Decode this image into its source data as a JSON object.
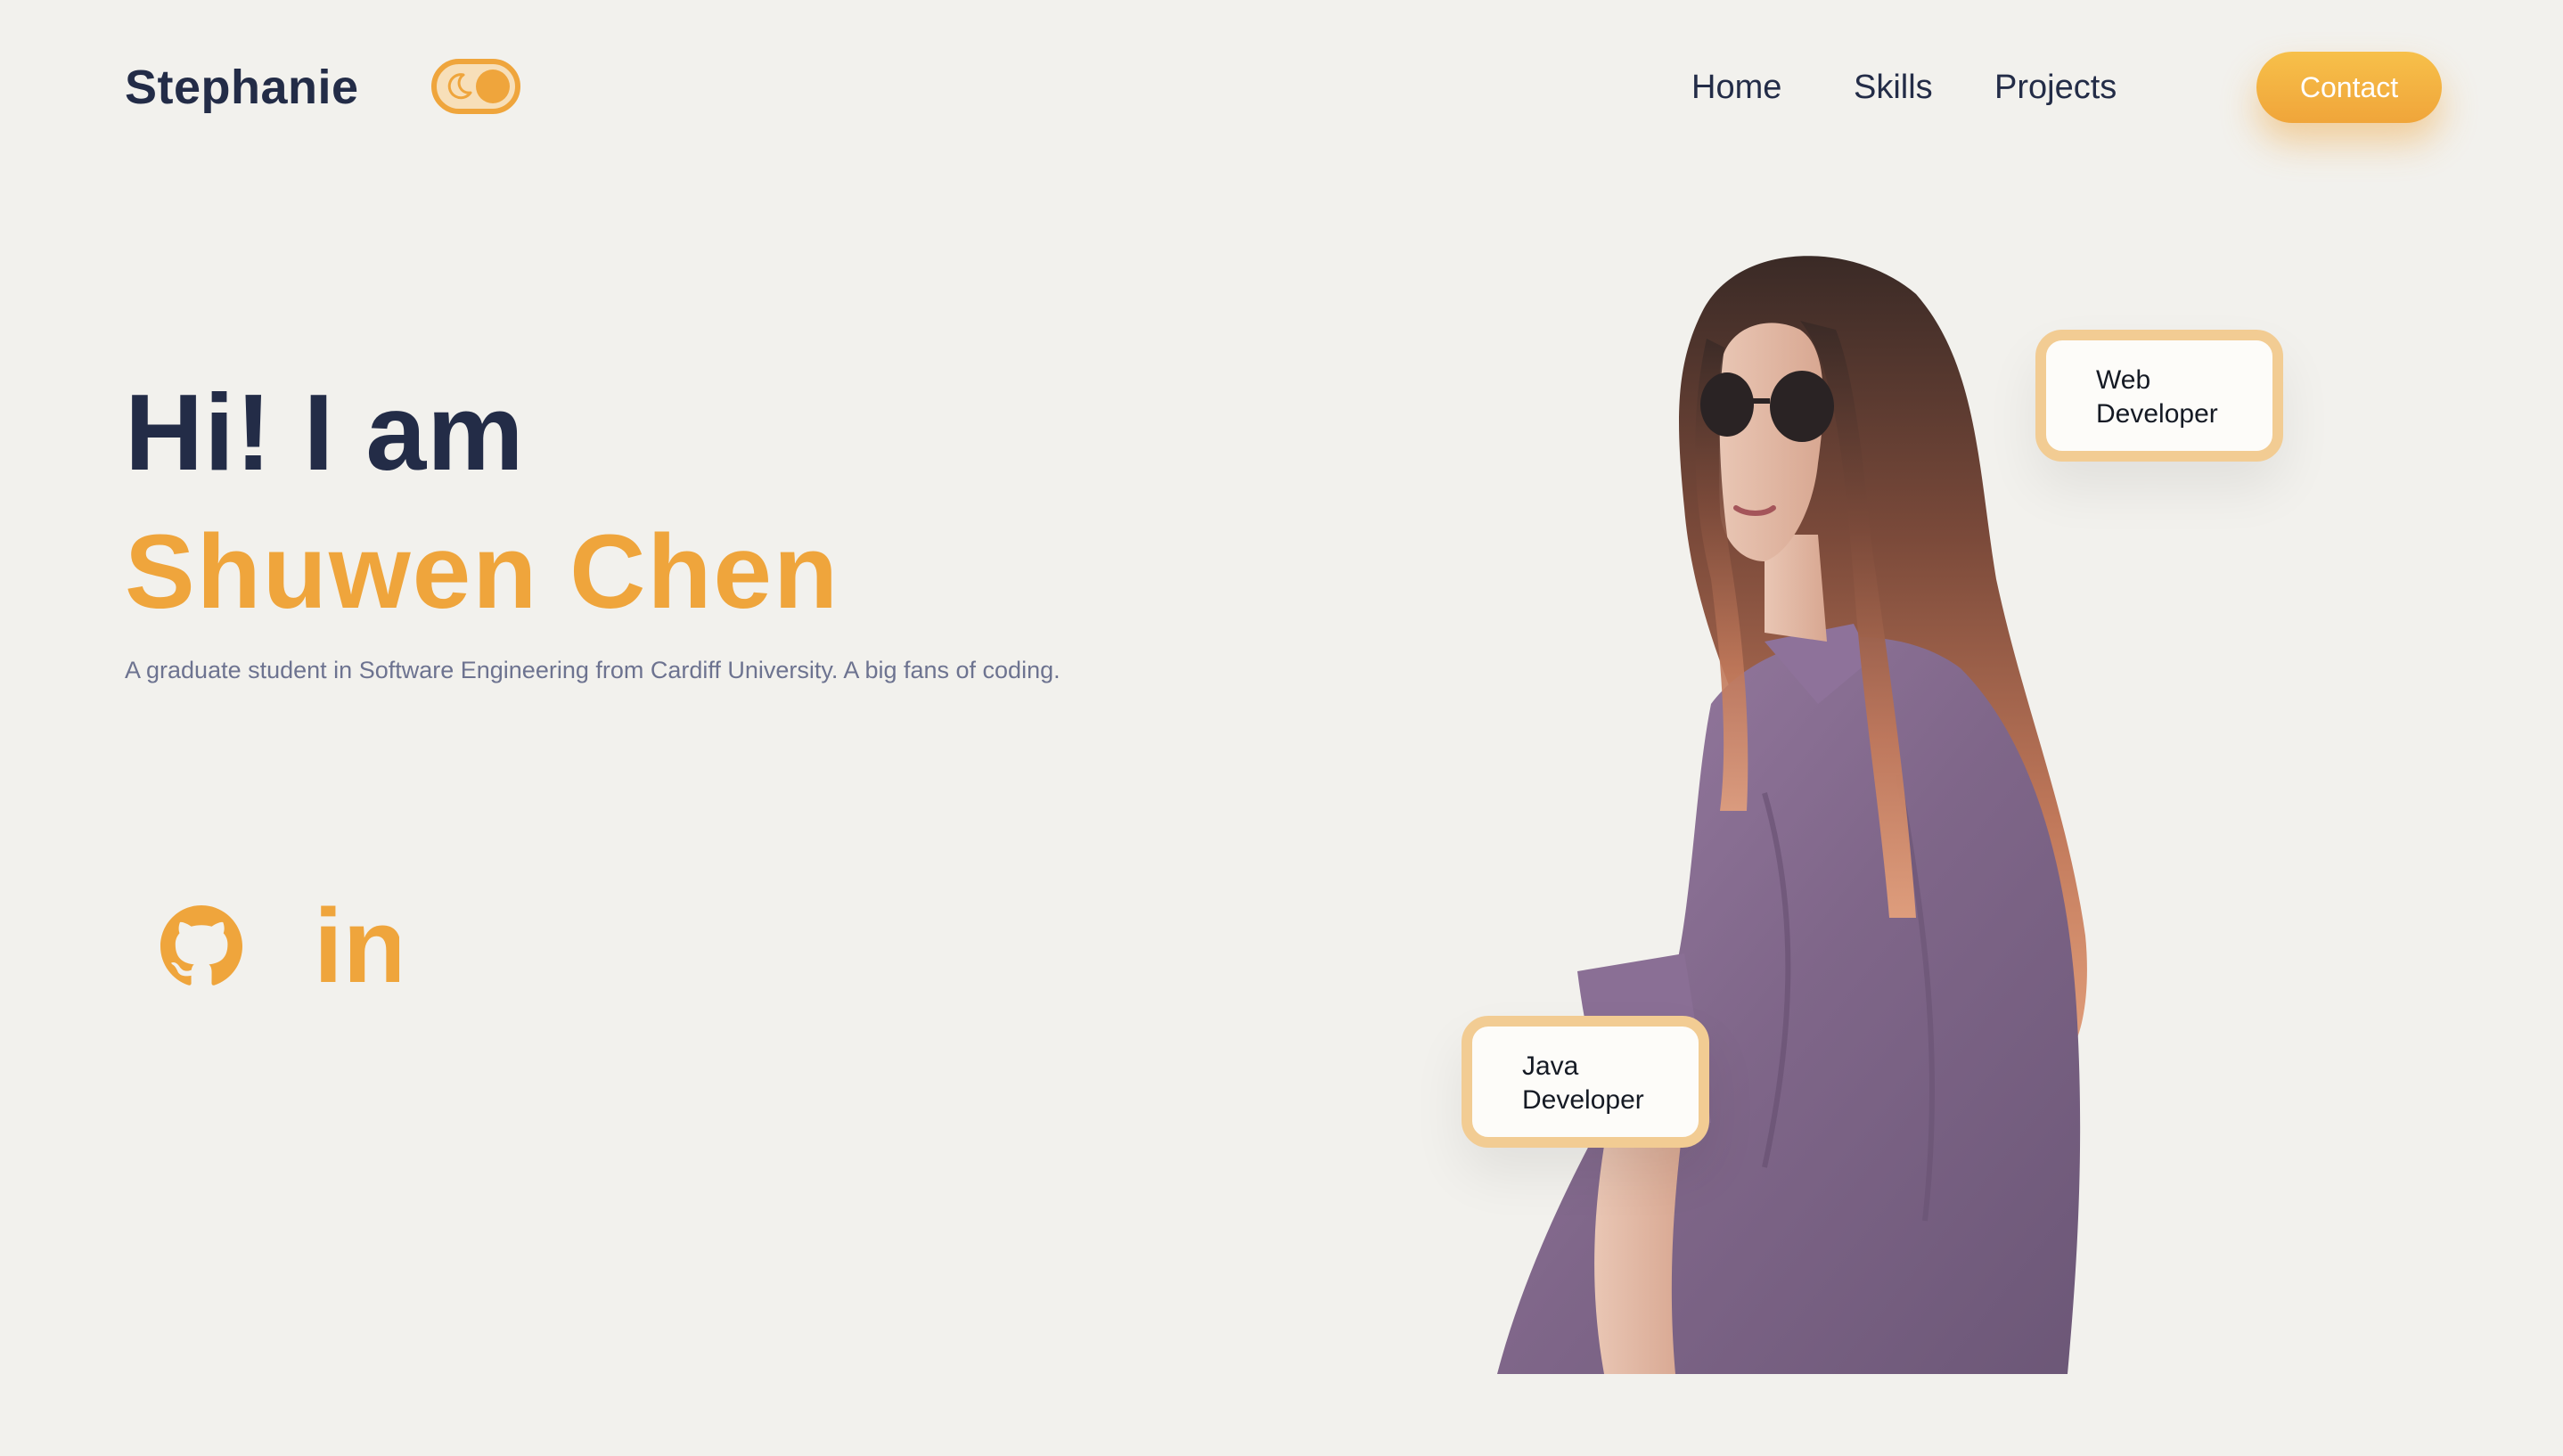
{
  "header": {
    "logo": "Stephanie",
    "theme_toggle_icon": "moon-icon",
    "nav": [
      {
        "label": "Home"
      },
      {
        "label": "Skills"
      },
      {
        "label": "Projects"
      }
    ],
    "contact_label": "Contact"
  },
  "hero": {
    "greeting": "Hi! I am",
    "name": "Shuwen Chen",
    "subtitle": "A graduate student in Software Engineering from Cardiff University. A big fans of coding.",
    "social": [
      {
        "icon": "github-icon"
      },
      {
        "icon": "linkedin-icon",
        "text": "in"
      }
    ],
    "badges": [
      {
        "line1": "Web",
        "line2": "Developer"
      },
      {
        "line1": "Java",
        "line2": "Developer"
      }
    ]
  },
  "colors": {
    "background": "#f2f1ed",
    "navy": "#232c47",
    "accent": "#efa53c",
    "badge_border": "#f2cc93",
    "subtitle": "#6d7390"
  }
}
